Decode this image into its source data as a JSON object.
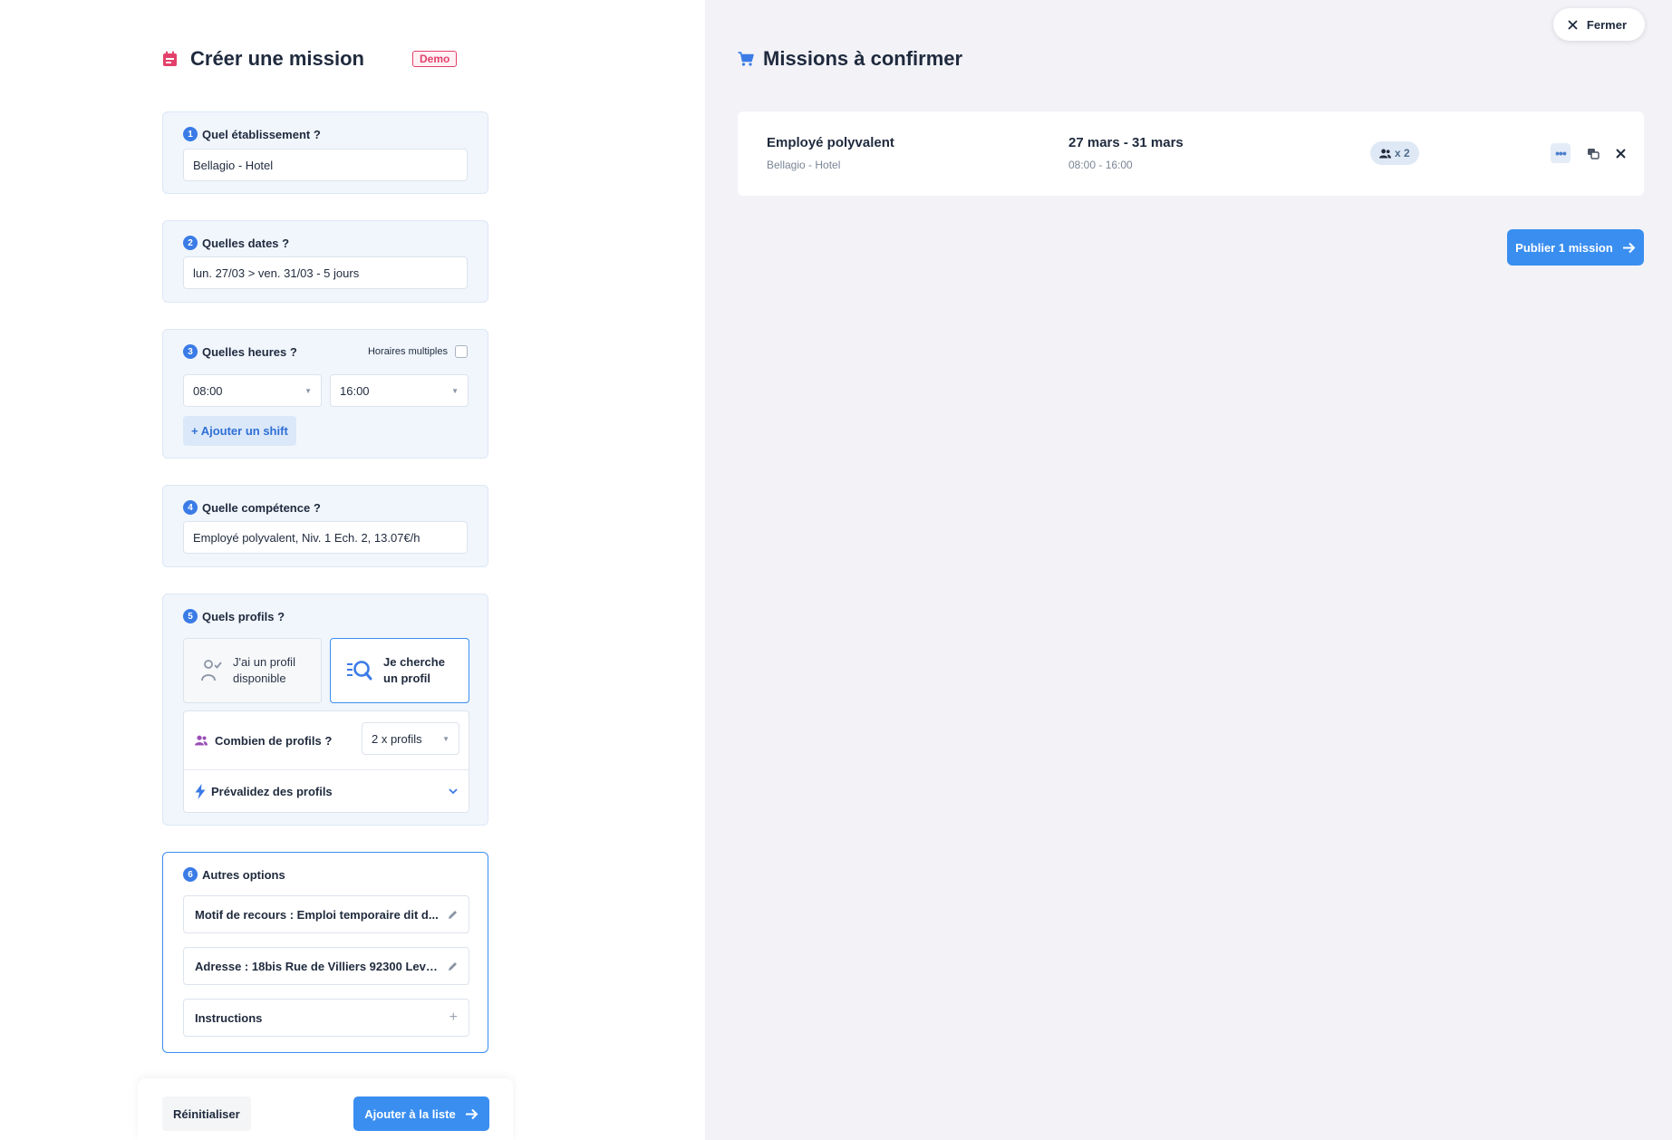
{
  "left": {
    "title": "Créer une mission",
    "demo_badge": "Demo",
    "step1": {
      "num": "1",
      "label": "Quel établissement ?",
      "value": "Bellagio - Hotel"
    },
    "step2": {
      "num": "2",
      "label": "Quelles dates ?",
      "value": "lun. 27/03 > ven. 31/03 - 5 jours"
    },
    "step3": {
      "num": "3",
      "label": "Quelles heures ?",
      "multi_label": "Horaires multiples",
      "multi_checked": false,
      "start": "08:00",
      "end": "16:00",
      "add_shift": "+ Ajouter un shift"
    },
    "step4": {
      "num": "4",
      "label": "Quelle compétence ?",
      "value": "Employé polyvalent, Niv. 1 Ech. 2, 13.07€/h"
    },
    "step5": {
      "num": "5",
      "label": "Quels profils ?",
      "option_available_line1": "J'ai un profil",
      "option_available_line2": "disponible",
      "option_search_line1": "Je cherche",
      "option_search_line2": "un profil",
      "selected_option": "search",
      "count_label": "Combien de profils ?",
      "count_value": "2 x profils",
      "prevalidate_label": "Prévalidez des profils"
    },
    "step6": {
      "num": "6",
      "label": "Autres options",
      "motif": "Motif de recours : Emploi temporaire dit d...",
      "adresse": "Adresse : 18bis Rue de Villiers 92300 Leva...",
      "instructions": "Instructions"
    },
    "footer": {
      "reset": "Réinitialiser",
      "add": "Ajouter à la liste"
    }
  },
  "right": {
    "close": "Fermer",
    "title": "Missions à confirmer",
    "mission": {
      "title": "Employé polyvalent",
      "place": "Bellagio - Hotel",
      "dates": "27 mars - 31 mars",
      "hours": "08:00 - 16:00",
      "count": "x 2"
    },
    "publish": "Publier 1 mission"
  },
  "colors": {
    "accent": "#3a8ef0",
    "demo": "#e2416b",
    "profile_icon": "#9b4fb5"
  },
  "icons": [
    "calendar-icon",
    "cart-icon",
    "close-icon",
    "user-check-icon",
    "search-profile-icon",
    "users-icon",
    "bolt-icon",
    "chevron-down-icon",
    "pencil-icon",
    "plus-icon",
    "arrow-right-icon",
    "more-icon",
    "copy-icon"
  ]
}
